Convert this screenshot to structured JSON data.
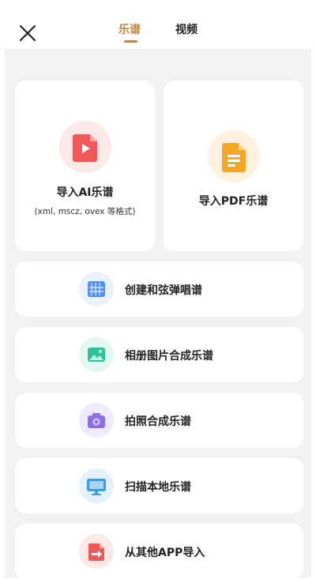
{
  "header": {
    "close_icon": "close-icon",
    "tabs": [
      {
        "label": "乐谱",
        "active": true
      },
      {
        "label": "视频",
        "active": false
      }
    ],
    "active_color": "#c8823d"
  },
  "import_cards": [
    {
      "title": "导入AI乐谱",
      "subtitle": "(xml, mscz, ovex 等格式)",
      "icon": "video-file-icon",
      "color": "#f0585a"
    },
    {
      "title": "导入PDF乐谱",
      "icon": "document-icon",
      "color": "#f5a623"
    }
  ],
  "menu_items": [
    {
      "label": "创建和弦弹唱谱",
      "icon": "keyboard-grid-icon",
      "color": "#4d8ef7"
    },
    {
      "label": "相册图片合成乐谱",
      "icon": "image-icon",
      "color": "#2fc09a"
    },
    {
      "label": "拍照合成乐谱",
      "icon": "camera-icon",
      "color": "#8c6ee8"
    },
    {
      "label": "扫描本地乐谱",
      "icon": "monitor-icon",
      "color": "#3d9ae8"
    },
    {
      "label": "从其他APP导入",
      "icon": "import-file-icon",
      "color": "#f0585a"
    }
  ]
}
